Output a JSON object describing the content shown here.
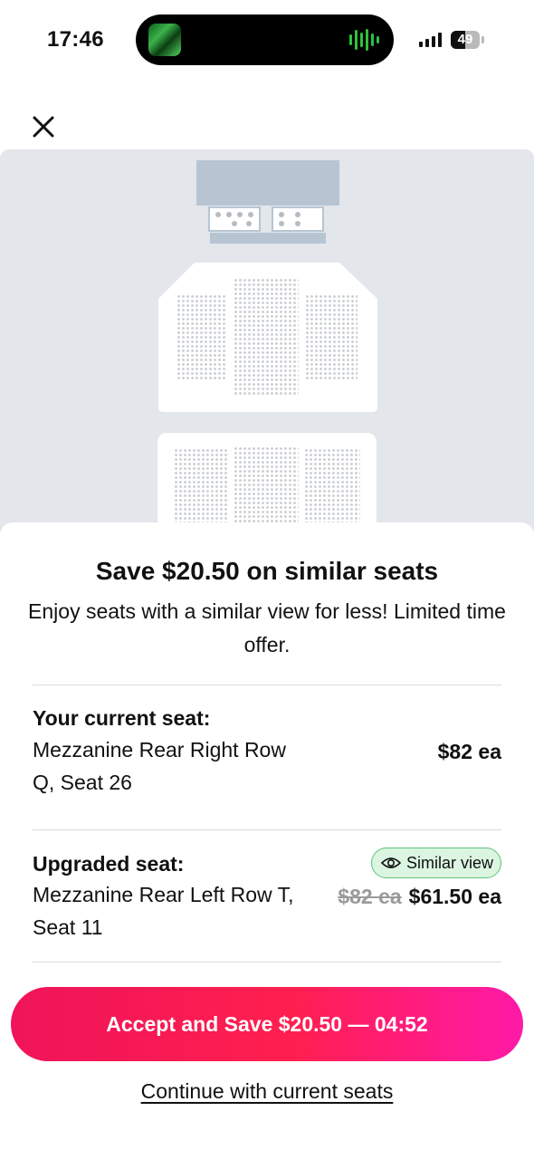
{
  "status_bar": {
    "time": "17:46",
    "battery": "49"
  },
  "offer": {
    "headline": "Save $20.50 on similar seats",
    "subtext": "Enjoy seats with a similar view for less! Limited time offer."
  },
  "current_seat": {
    "label": "Your current seat:",
    "description": "Mezzanine Rear Right Row Q, Seat 26",
    "price": "$82 ea"
  },
  "upgraded_seat": {
    "label": "Upgraded seat:",
    "badge": "Similar view",
    "description": "Mezzanine Rear Left Row T, Seat 11",
    "old_price": "$82 ea",
    "new_price": "$61.50 ea"
  },
  "actions": {
    "accept_label": "Accept and Save $20.50  —  04:52",
    "continue_label": "Continue with current seats"
  },
  "colors": {
    "accent_start": "#f0145a",
    "accent_end": "#ff1aa8",
    "badge_bg": "#dbf5e1",
    "badge_border": "#5fc07a"
  },
  "icons": [
    "close-icon",
    "eye-icon",
    "signal-icon",
    "battery-icon"
  ]
}
